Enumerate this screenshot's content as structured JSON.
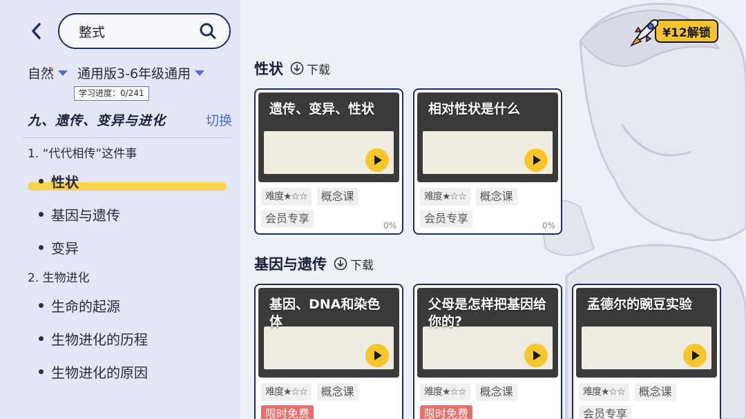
{
  "search": {
    "value": "整式"
  },
  "filters": {
    "subject": "自然",
    "edition": "通用版3-6年级通用",
    "progress": "学习进度：0/241"
  },
  "chapter": {
    "title": "九、遗传、变异与进化",
    "switch_label": "切换"
  },
  "nav": {
    "sections": [
      {
        "title": "1. “代代相传”这件事",
        "items": [
          "性状",
          "基因与遗传",
          "变异"
        ]
      },
      {
        "title": "2. 生物进化",
        "items": [
          "生命的起源",
          "生物进化的历程",
          "生物进化的原因"
        ]
      }
    ],
    "active": "性状"
  },
  "unlock": {
    "label": "¥12解锁"
  },
  "sections": [
    {
      "title": "性状",
      "download_label": "下载",
      "cards": [
        {
          "title": "遗传、变异、性状",
          "difficulty": "难度★☆☆",
          "type": "概念课",
          "access": "会员专享",
          "progress": "0%"
        },
        {
          "title": "相对性状是什么",
          "difficulty": "难度★☆☆",
          "type": "概念课",
          "access": "会员专享",
          "progress": "0%"
        }
      ]
    },
    {
      "title": "基因与遗传",
      "download_label": "下载",
      "cards": [
        {
          "title": "基因、DNA和染色体",
          "difficulty": "难度★☆☆",
          "type": "概念课",
          "access": "限时免费"
        },
        {
          "title": "父母是怎样把基因给你的?",
          "difficulty": "难度★☆☆",
          "type": "概念课",
          "access": "限时免费"
        },
        {
          "title": "孟德尔的豌豆实验",
          "difficulty": "难度★☆☆",
          "type": "概念课",
          "access": "会员专享"
        }
      ]
    }
  ],
  "colors": {
    "accent": "#4a6cd9",
    "highlight": "#f6d54a",
    "free": "#e96e6e",
    "border": "#1f2b5c"
  }
}
